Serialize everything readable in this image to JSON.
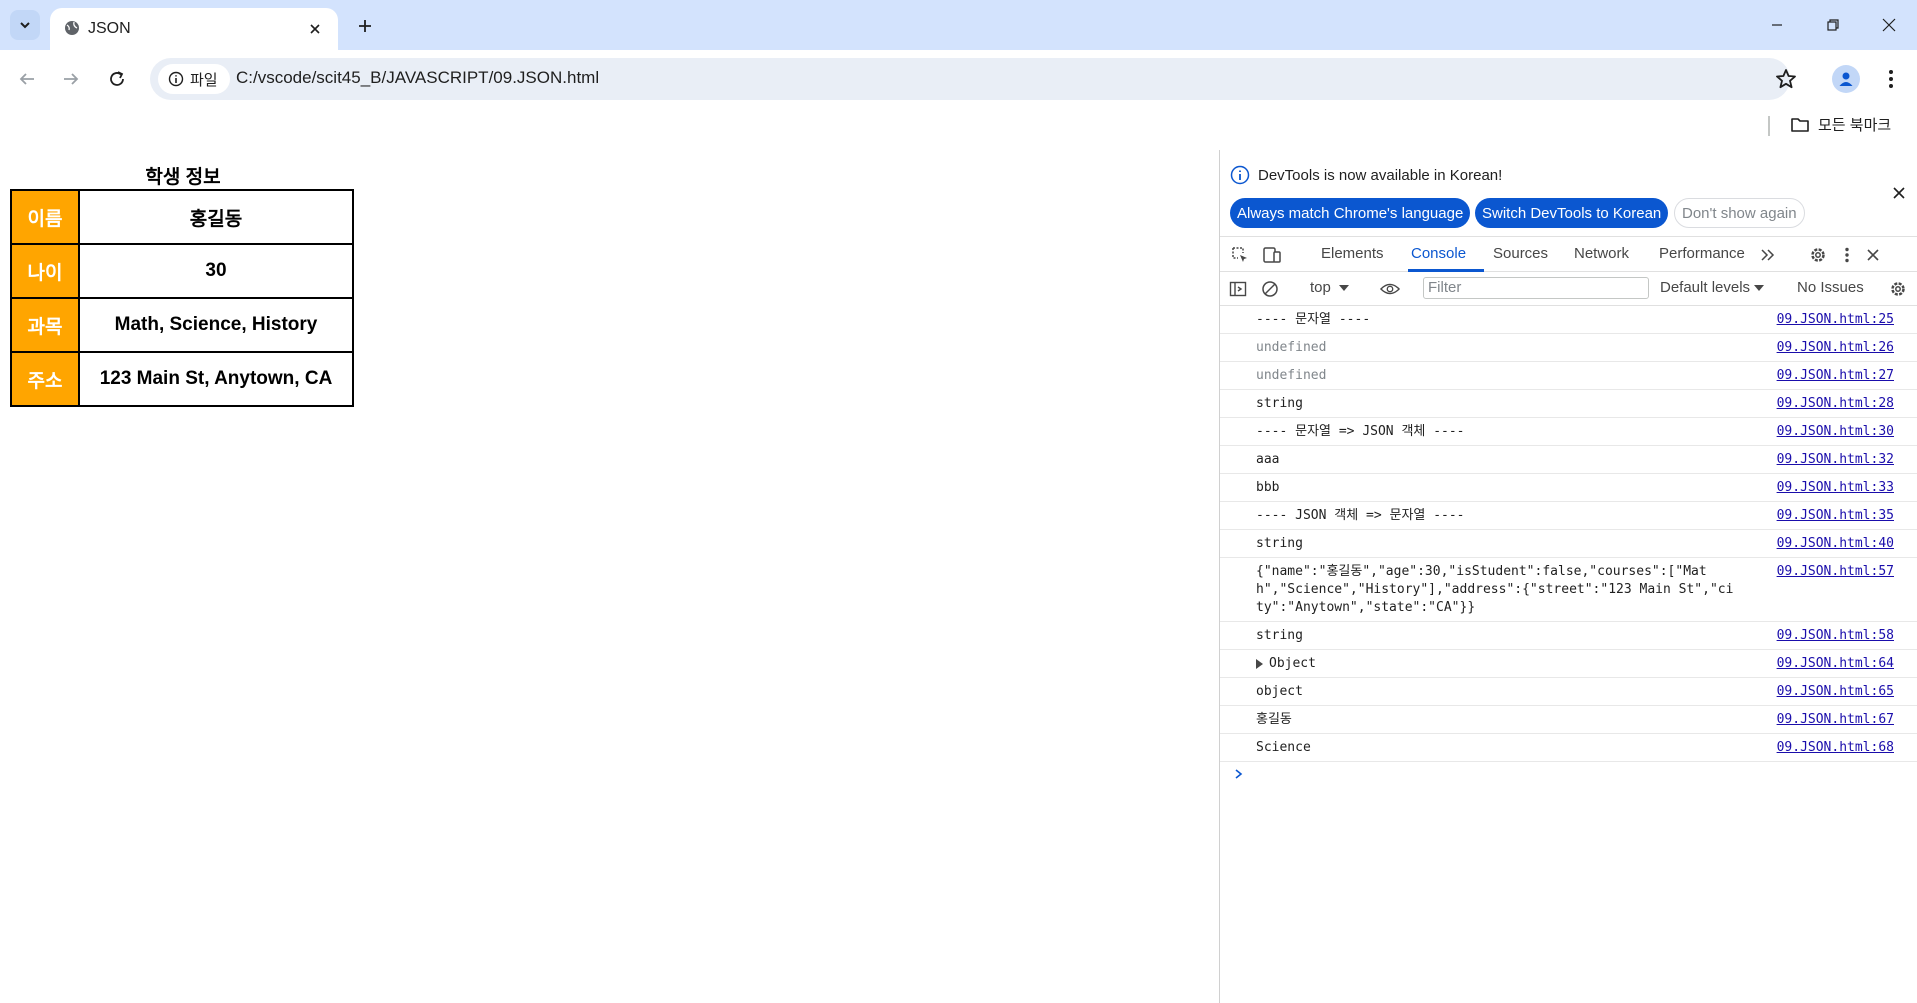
{
  "browser": {
    "tab_title": "JSON",
    "url_chip": "파일",
    "url": "C:/vscode/scit45_B/JAVASCRIPT/09.JSON.html",
    "bookmarks_all": "모든 북마크"
  },
  "page": {
    "caption": "학생 정보",
    "rows": [
      {
        "label": "이름",
        "value": "홍길동"
      },
      {
        "label": "나이",
        "value": "30"
      },
      {
        "label": "과목",
        "value": "Math, Science, History"
      },
      {
        "label": "주소",
        "value": "123 Main St, Anytown, CA"
      }
    ],
    "label_color": "#ffa500"
  },
  "devtools": {
    "info_message": "DevTools is now available in Korean!",
    "btn_match": "Always match Chrome's language",
    "btn_switch": "Switch DevTools to Korean",
    "btn_dismiss": "Don't show again",
    "tabs": [
      "Elements",
      "Console",
      "Sources",
      "Network",
      "Performance"
    ],
    "active_tab": "Console",
    "context": "top",
    "filter_placeholder": "Filter",
    "levels": "Default levels",
    "issues": "No Issues",
    "console": [
      {
        "text": "---- 문자열 ----",
        "source": "09.JSON.html:25"
      },
      {
        "text": "undefined",
        "source": "09.JSON.html:26",
        "dim": true
      },
      {
        "text": "undefined",
        "source": "09.JSON.html:27",
        "dim": true
      },
      {
        "text": "string",
        "source": "09.JSON.html:28"
      },
      {
        "text": "---- 문자열 => JSON 객체 ----",
        "source": "09.JSON.html:30"
      },
      {
        "text": "aaa",
        "source": "09.JSON.html:32"
      },
      {
        "text": "bbb",
        "source": "09.JSON.html:33"
      },
      {
        "text": "---- JSON 객체 => 문자열 ----",
        "source": "09.JSON.html:35"
      },
      {
        "text": "string",
        "source": "09.JSON.html:40"
      },
      {
        "text": "{\"name\":\"홍길동\",\"age\":30,\"isStudent\":false,\"courses\":[\"Math\",\"Science\",\"History\"],\"address\":{\"street\":\"123 Main St\",\"city\":\"Anytown\",\"state\":\"CA\"}}",
        "source": "09.JSON.html:57"
      },
      {
        "text": "string",
        "source": "09.JSON.html:58"
      },
      {
        "text": "Object",
        "source": "09.JSON.html:64",
        "expandable": true
      },
      {
        "text": "object",
        "source": "09.JSON.html:65"
      },
      {
        "text": "홍길동",
        "source": "09.JSON.html:67"
      },
      {
        "text": "Science",
        "source": "09.JSON.html:68"
      }
    ]
  }
}
